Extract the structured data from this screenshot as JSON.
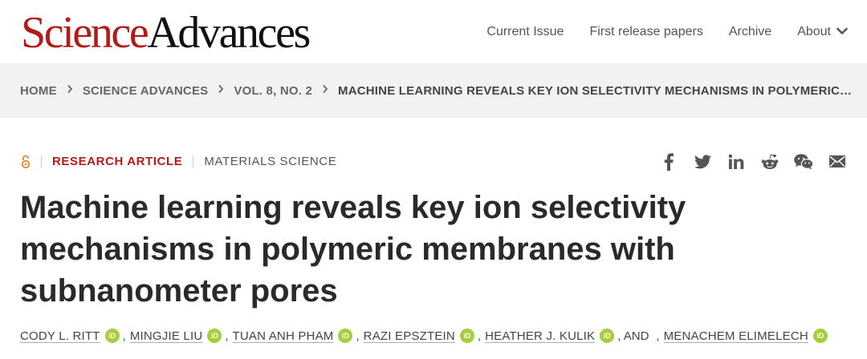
{
  "header": {
    "logo_part1": "Science",
    "logo_part2": "Advances",
    "nav": [
      {
        "label": "Current Issue"
      },
      {
        "label": "First release papers"
      },
      {
        "label": "Archive"
      },
      {
        "label": "About"
      }
    ]
  },
  "breadcrumb": [
    "HOME",
    "SCIENCE ADVANCES",
    "VOL. 8, NO. 2",
    "MACHINE LEARNING REVEALS KEY ION SELECTIVITY MECHANISMS IN POLYMERIC…"
  ],
  "article": {
    "type": "RESEARCH ARTICLE",
    "subject": "MATERIALS SCIENCE",
    "title": "Machine learning reveals key ion selectivity mechanisms in polymeric membranes with subnanometer pores",
    "authors": [
      "CODY L. RITT",
      "MINGJIE LIU",
      "TUAN ANH PHAM",
      "RAZI EPSZTEIN",
      "HEATHER J. KULIK",
      "MENACHEM ELIMELECH"
    ],
    "and_label": ", AND",
    "orcid_label": "iD"
  },
  "share_icons": [
    "facebook-icon",
    "twitter-icon",
    "linkedin-icon",
    "reddit-icon",
    "wechat-icon",
    "email-icon"
  ],
  "colors": {
    "brand": "#b31b1b",
    "orcid": "#a6ce39",
    "open_access": "#e8862d"
  }
}
